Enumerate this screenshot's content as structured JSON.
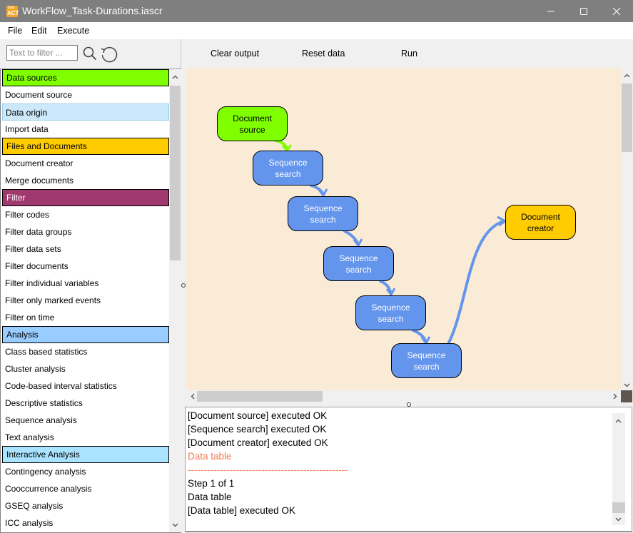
{
  "window": {
    "title": "WorkFlow_Task-Durations.iascr",
    "logo_top": "inter",
    "logo_bottom": "ACT"
  },
  "menu": [
    "File",
    "Edit",
    "Execute"
  ],
  "filter": {
    "placeholder": "Text to filter ...",
    "value": ""
  },
  "toolbar": {
    "clear_output": "Clear output",
    "reset_data": "Reset data",
    "run": "Run"
  },
  "tools": [
    {
      "label": "Data sources",
      "type": "category",
      "color": "#7fff00"
    },
    {
      "label": "Document source",
      "type": "item"
    },
    {
      "label": "Data origin",
      "type": "category-light",
      "color": "#cce8fb"
    },
    {
      "label": "Import data",
      "type": "item"
    },
    {
      "label": "Files and Documents",
      "type": "category",
      "color": "#ffcc00"
    },
    {
      "label": "Document creator",
      "type": "item"
    },
    {
      "label": "Merge documents",
      "type": "item"
    },
    {
      "label": "Filter",
      "type": "category",
      "color": "#a0396d",
      "text_color": "#ffffff"
    },
    {
      "label": "Filter codes",
      "type": "item"
    },
    {
      "label": "Filter data groups",
      "type": "item"
    },
    {
      "label": "Filter data sets",
      "type": "item"
    },
    {
      "label": "Filter documents",
      "type": "item"
    },
    {
      "label": "Filter individual variables",
      "type": "item"
    },
    {
      "label": "Filter only marked events",
      "type": "item"
    },
    {
      "label": "Filter on time",
      "type": "item"
    },
    {
      "label": "Analysis",
      "type": "category",
      "color": "#99ccff"
    },
    {
      "label": "Class based statistics",
      "type": "item"
    },
    {
      "label": "Cluster analysis",
      "type": "item"
    },
    {
      "label": "Code-based interval statistics",
      "type": "item"
    },
    {
      "label": "Descriptive statistics",
      "type": "item"
    },
    {
      "label": "Sequence analysis",
      "type": "item"
    },
    {
      "label": "Text analysis",
      "type": "item"
    },
    {
      "label": "Interactive Analysis",
      "type": "category",
      "color": "#aae3ff"
    },
    {
      "label": "Contingency analysis",
      "type": "item"
    },
    {
      "label": "Cooccurrence analysis",
      "type": "item"
    },
    {
      "label": "GSEQ analysis",
      "type": "item"
    },
    {
      "label": "ICC analysis",
      "type": "item"
    }
  ],
  "workflow": {
    "nodes": [
      {
        "label1": "Document",
        "label2": "source",
        "color": "green"
      },
      {
        "label1": "Sequence",
        "label2": "search",
        "color": "blue"
      },
      {
        "label1": "Sequence",
        "label2": "search",
        "color": "blue"
      },
      {
        "label1": "Sequence",
        "label2": "search",
        "color": "blue"
      },
      {
        "label1": "Sequence",
        "label2": "search",
        "color": "blue"
      },
      {
        "label1": "Sequence",
        "label2": "search",
        "color": "blue"
      },
      {
        "label1": "Document",
        "label2": "creator",
        "color": "yellow"
      }
    ],
    "colors": {
      "green": "#7fff00",
      "blue": "#6495ed",
      "yellow": "#ffcc00",
      "canvas": "#faebd7"
    }
  },
  "output": {
    "lines": [
      {
        "text": "[Document source] executed OK",
        "style": "normal"
      },
      {
        "text": "[Sequence search] executed OK",
        "style": "normal"
      },
      {
        "text": "[Document creator] executed OK",
        "style": "normal"
      },
      {
        "text": "Data table",
        "style": "red"
      },
      {
        "text": "--------------------------------------------------",
        "style": "red"
      },
      {
        "text": "Step 1 of 1",
        "style": "normal"
      },
      {
        "text": "Data table",
        "style": "normal"
      },
      {
        "text": "[Data table] executed OK",
        "style": "normal"
      }
    ],
    "error_color": "#f07850"
  }
}
